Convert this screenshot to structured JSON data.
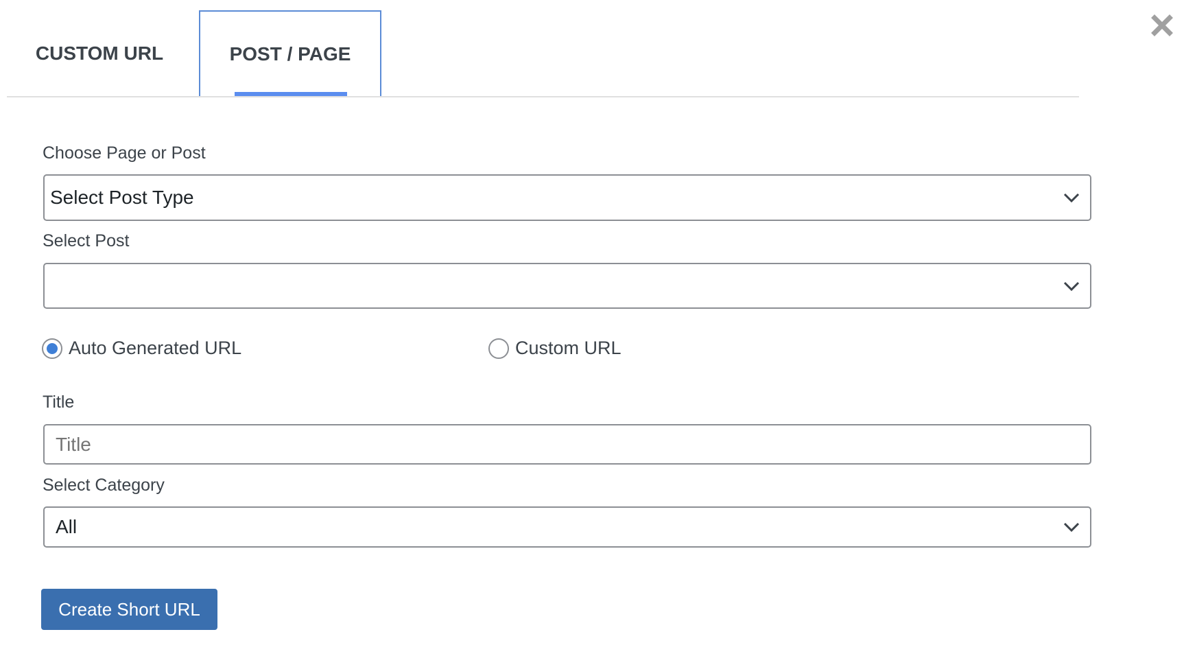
{
  "tabs": [
    {
      "label": "CUSTOM URL",
      "active": false
    },
    {
      "label": "POST / PAGE",
      "active": true
    }
  ],
  "close_icon": "close-icon",
  "colors": {
    "accent": "#5b8def",
    "button": "#3a6faf",
    "radio_checked": "#3f7fd6"
  },
  "form": {
    "post_type": {
      "label": "Choose Page or Post",
      "value": "Select Post Type"
    },
    "post": {
      "label": "Select Post",
      "value": ""
    },
    "url_mode": {
      "options": [
        {
          "label": "Auto Generated URL",
          "checked": true
        },
        {
          "label": "Custom URL",
          "checked": false
        }
      ]
    },
    "title": {
      "label": "Title",
      "placeholder": "Title",
      "value": ""
    },
    "category": {
      "label": "Select Category",
      "value": "All"
    },
    "submit_label": "Create Short URL"
  }
}
